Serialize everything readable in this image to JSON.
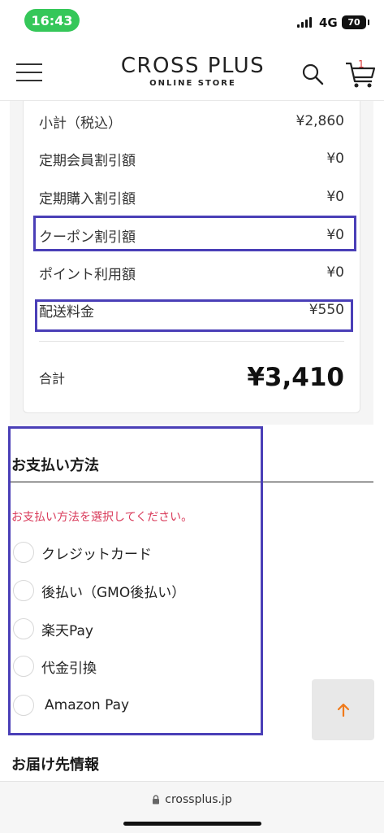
{
  "status_bar": {
    "time": "16:43",
    "network": "4G",
    "battery": "70"
  },
  "header": {
    "logo_main": "CROSS PLUS",
    "logo_sub": "ONLINE STORE",
    "cart_count": "1",
    "icons": [
      "menu-icon",
      "search-icon",
      "cart-icon"
    ]
  },
  "summary": {
    "rows": [
      {
        "label": "小計（税込）",
        "value": "¥2,860"
      },
      {
        "label": "定期会員割引額",
        "value": "¥0"
      },
      {
        "label": "定期購入割引額",
        "value": "¥0"
      },
      {
        "label": "クーポン割引額",
        "value": "¥0"
      },
      {
        "label": "ポイント利用額",
        "value": "¥0"
      },
      {
        "label": "配送料金",
        "value": "¥550"
      }
    ],
    "total_label": "合計",
    "total_value": "¥3,410"
  },
  "payment": {
    "title": "お支払い方法",
    "error": "お支払い方法を選択してください。",
    "options": [
      "クレジットカード",
      "後払い（GMO後払い）",
      "楽天Pay",
      "代金引換",
      "Amazon Pay"
    ]
  },
  "shipping": {
    "title": "お届け先情報"
  },
  "browser": {
    "url": "crossplus.jp"
  },
  "colors": {
    "highlight": "#4a3fb7",
    "error": "#d93a5a",
    "accent_arrow": "#f07a1a",
    "time_pill": "#35c759"
  }
}
